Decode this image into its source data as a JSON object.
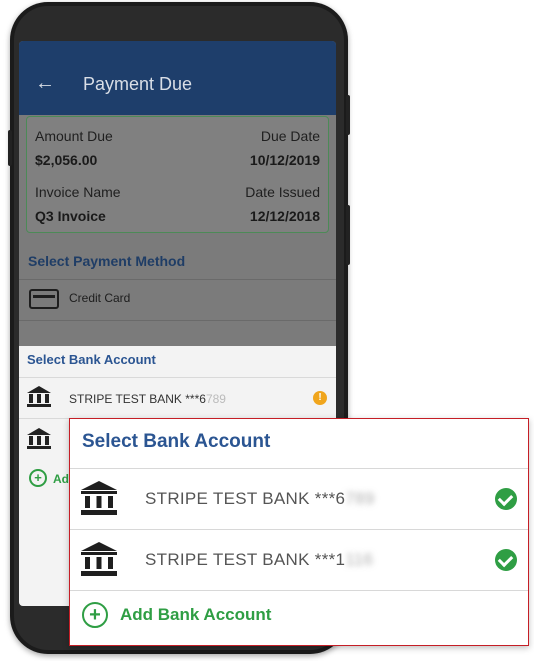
{
  "app": {
    "title": "Payment Due",
    "back_icon": "arrow-left-icon"
  },
  "invoice": {
    "amount_due_label": "Amount Due",
    "amount_due": "$2,056.00",
    "due_date_label": "Due Date",
    "due_date": "10/12/2019",
    "invoice_name_label": "Invoice Name",
    "invoice_name": "Q3 Invoice",
    "date_issued_label": "Date Issued",
    "date_issued": "12/12/2018"
  },
  "payment": {
    "section_title": "Select Payment Method",
    "methods": [
      {
        "label": "Credit Card",
        "icon": "credit-card-icon"
      }
    ]
  },
  "bank_sheet": {
    "title": "Select Bank Account",
    "accounts": [
      {
        "name": "STRIPE TEST BANK ***6",
        "masked_tail": "789",
        "status_icon": "warning-icon"
      },
      {
        "name": "STRIPE TEST BANK ***1",
        "masked_tail": "116",
        "status_icon": "check-icon"
      }
    ],
    "add_label": "Add",
    "add_icon": "plus-circle-icon"
  },
  "zoom_panel": {
    "title": "Select Bank Account",
    "accounts": [
      {
        "name": "STRIPE TEST BANK ***6",
        "masked_tail": "789",
        "status_icon": "check-circle-icon"
      },
      {
        "name": "STRIPE TEST BANK ***1",
        "masked_tail": "116",
        "status_icon": "check-circle-icon"
      }
    ],
    "add_label": "Add Bank Account",
    "add_icon": "plus-circle-icon"
  },
  "colors": {
    "app_bar": "#1e3e6b",
    "accent_blue": "#2b5592",
    "success_green": "#2f9e44",
    "warning_orange": "#f0a51c",
    "highlight_border": "#c51e26"
  }
}
